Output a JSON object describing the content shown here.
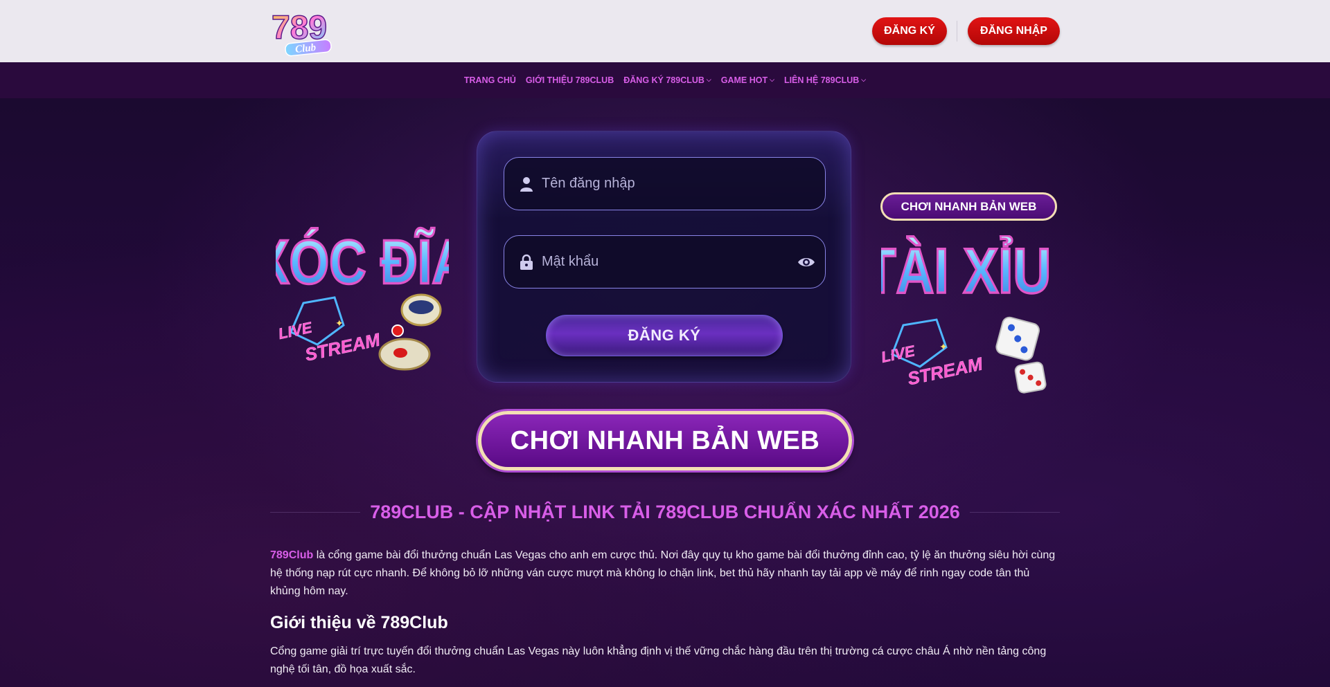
{
  "header": {
    "logo_text": "789",
    "logo_sub": "Club",
    "register_label": "ĐĂNG KÝ",
    "login_label": "ĐĂNG NHẬP"
  },
  "nav": {
    "items": [
      {
        "label": "TRANG CHỦ",
        "dropdown": false
      },
      {
        "label": "GIỚI THIỆU 789CLUB",
        "dropdown": false
      },
      {
        "label": "ĐĂNG KÝ 789CLUB",
        "dropdown": true
      },
      {
        "label": "GAME HOT",
        "dropdown": true
      },
      {
        "label": "LIÊN HỆ 789CLUB",
        "dropdown": true
      }
    ]
  },
  "form": {
    "username_placeholder": "Tên đăng nhập",
    "password_placeholder": "Mật khẩu",
    "submit_label": "ĐĂNG KÝ"
  },
  "promos": {
    "left_title": "XÓC ĐĨA",
    "left_tag1": "LIVE",
    "left_tag2": "STREAM",
    "right_title": "TÀI XỈU",
    "right_tag1": "LIVE",
    "right_tag2": "STREAM",
    "small_pill_label": "CHƠI NHANH BẢN WEB",
    "big_pill_label": "CHƠI NHANH BẢN WEB"
  },
  "article": {
    "title": "789CLUB - CẬP NHẬT LINK TẢI 789CLUB CHUẨN XÁC NHẤT 2026",
    "intro_link": "789Club",
    "intro_text": " là cổng game bài đổi thưởng chuẩn Las Vegas cho anh em cược thủ. Nơi đây quy tụ kho game bài đổi thưởng đỉnh cao, tỷ lệ ăn thưởng siêu hời cùng hệ thống nạp rút cực nhanh. Để không bỏ lỡ những ván cược mượt mà không lo chặn link, bet thủ hãy nhanh tay tải app về máy để rinh ngay code tân thủ khủng hôm nay.",
    "heading": "Giới thiệu về 789Club",
    "para2": "Cổng game giải trí trực tuyến đổi thưởng chuẩn Las Vegas này luôn khẳng định vị thế vững chắc hàng đầu trên thị trường cá cược châu Á nhờ nền tảng công nghệ tối tân, đồ họa xuất sắc."
  },
  "colors": {
    "accent": "#d85ee8",
    "header_bg": "#ebe8ef",
    "nav_bg": "#2a0a3d",
    "button_red": "#c80d0d"
  }
}
